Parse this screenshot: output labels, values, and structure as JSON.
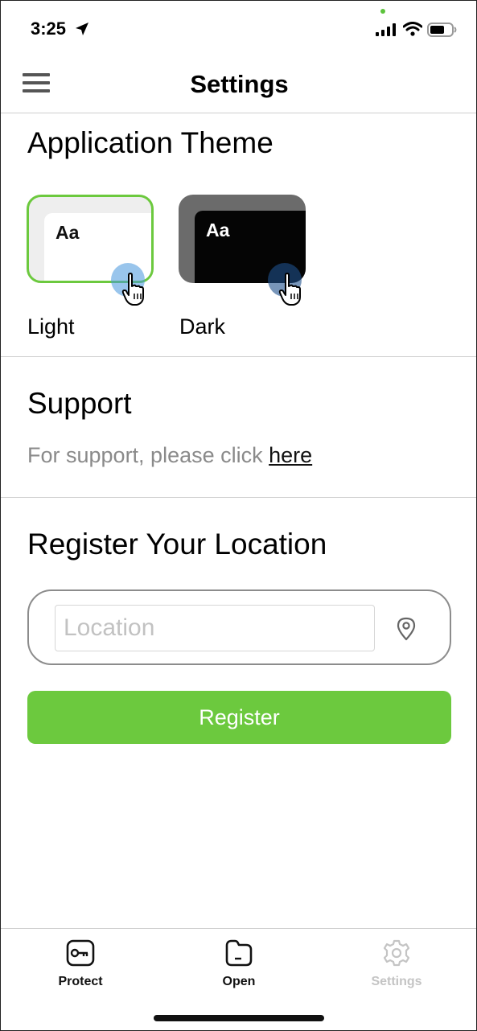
{
  "status_bar": {
    "time": "3:25"
  },
  "header": {
    "title": "Settings"
  },
  "theme": {
    "title": "Application Theme",
    "options": [
      {
        "label": "Light",
        "preview_text": "Aa",
        "selected": true
      },
      {
        "label": "Dark",
        "preview_text": "Aa",
        "selected": false
      }
    ]
  },
  "support": {
    "title": "Support",
    "text": "For support, please click ",
    "link_label": "here"
  },
  "location": {
    "title": "Register Your Location",
    "placeholder": "Location",
    "value": "",
    "register_label": "Register"
  },
  "tabs": [
    {
      "label": "Protect",
      "icon": "key-icon",
      "active": true
    },
    {
      "label": "Open",
      "icon": "folder-icon",
      "active": true
    },
    {
      "label": "Settings",
      "icon": "gear-icon",
      "active": false
    }
  ],
  "colors": {
    "accent": "#6cc93e",
    "inactive": "#c4c4c4",
    "muted_text": "#8a8a8a"
  }
}
